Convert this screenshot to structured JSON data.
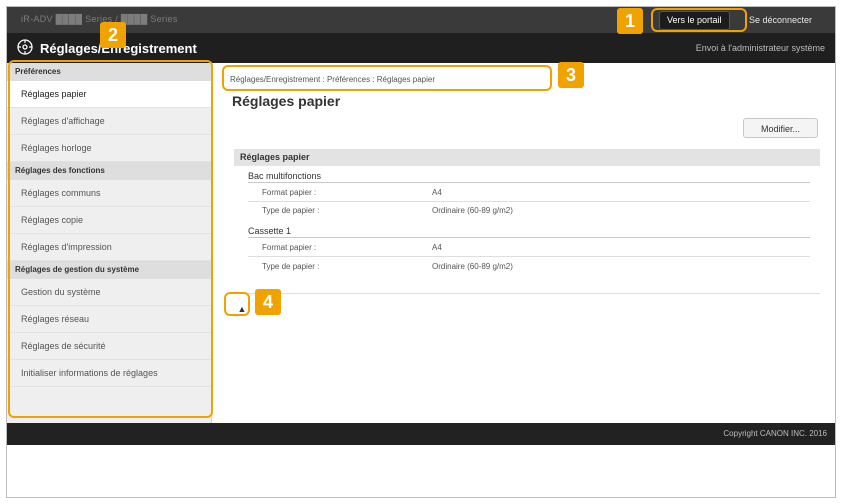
{
  "topbar": {
    "system_name": "iR-ADV ████ Series / ████ Series",
    "portal_button": "Vers le portail",
    "logout_link": "Se déconnecter"
  },
  "header": {
    "title": "Réglages/Enregistrement",
    "admin_text": "Envoi à l'administrateur système"
  },
  "sidebar": {
    "groups": [
      {
        "label": "Préférences",
        "items": [
          "Réglages papier",
          "Réglages d'affichage",
          "Réglages horloge"
        ]
      },
      {
        "label": "Réglages des fonctions",
        "items": [
          "Réglages communs",
          "Réglages copie",
          "Réglages d'impression"
        ]
      },
      {
        "label": "Réglages de gestion du système",
        "items": [
          "Gestion du système",
          "Réglages réseau",
          "Réglages de sécurité",
          "Initialiser informations de réglages"
        ]
      }
    ]
  },
  "main": {
    "breadcrumb": "Réglages/Enregistrement : Préférences : Réglages papier",
    "title": "Réglages papier",
    "modify_button": "Modifier...",
    "section_title": "Réglages papier",
    "sources": [
      {
        "name": "Bac multifonctions",
        "rows": [
          {
            "label": "Format papier :",
            "value": "A4"
          },
          {
            "label": "Type de papier :",
            "value": "Ordinaire (60-89 g/m2)"
          }
        ]
      },
      {
        "name": "Cassette 1",
        "rows": [
          {
            "label": "Format papier :",
            "value": "A4"
          },
          {
            "label": "Type de papier :",
            "value": "Ordinaire (60-89 g/m2)"
          }
        ]
      }
    ],
    "top_icon": "▲"
  },
  "footer": {
    "copyright": "Copyright CANON INC. 2016"
  },
  "callouts": [
    "1",
    "2",
    "3",
    "4"
  ],
  "colors": {
    "callout": "#f0a300",
    "topbar": "#3a3a3a",
    "titlebar": "#1f1f1f"
  }
}
